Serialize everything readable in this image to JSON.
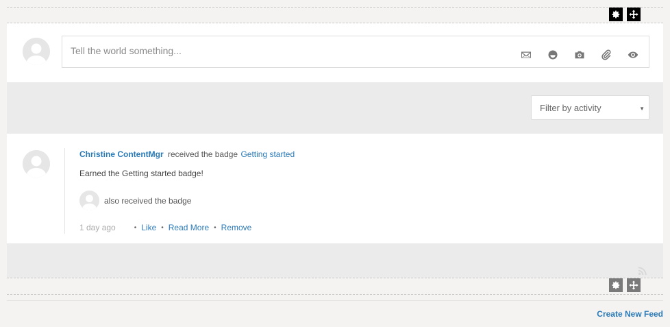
{
  "composer": {
    "placeholder": "Tell the world something...",
    "tools": [
      "envelope-icon",
      "emoticon-icon",
      "camera-icon",
      "paperclip-icon",
      "eye-icon"
    ]
  },
  "filter": {
    "selected": "Filter by activity"
  },
  "activity": {
    "author": "Christine ContentMgr",
    "verb": "received the badge",
    "badge_name": "Getting started",
    "message": "Earned the Getting started badge!",
    "also_text": "also received the badge",
    "time": "1 day ago",
    "actions": {
      "like": "Like",
      "read_more": "Read More",
      "remove": "Remove"
    }
  },
  "footer": {
    "create_feed": "Create New Feed"
  },
  "colors": {
    "link": "#2a7ab8",
    "band": "#ebebeb",
    "page_bg": "#f4f3f1"
  }
}
